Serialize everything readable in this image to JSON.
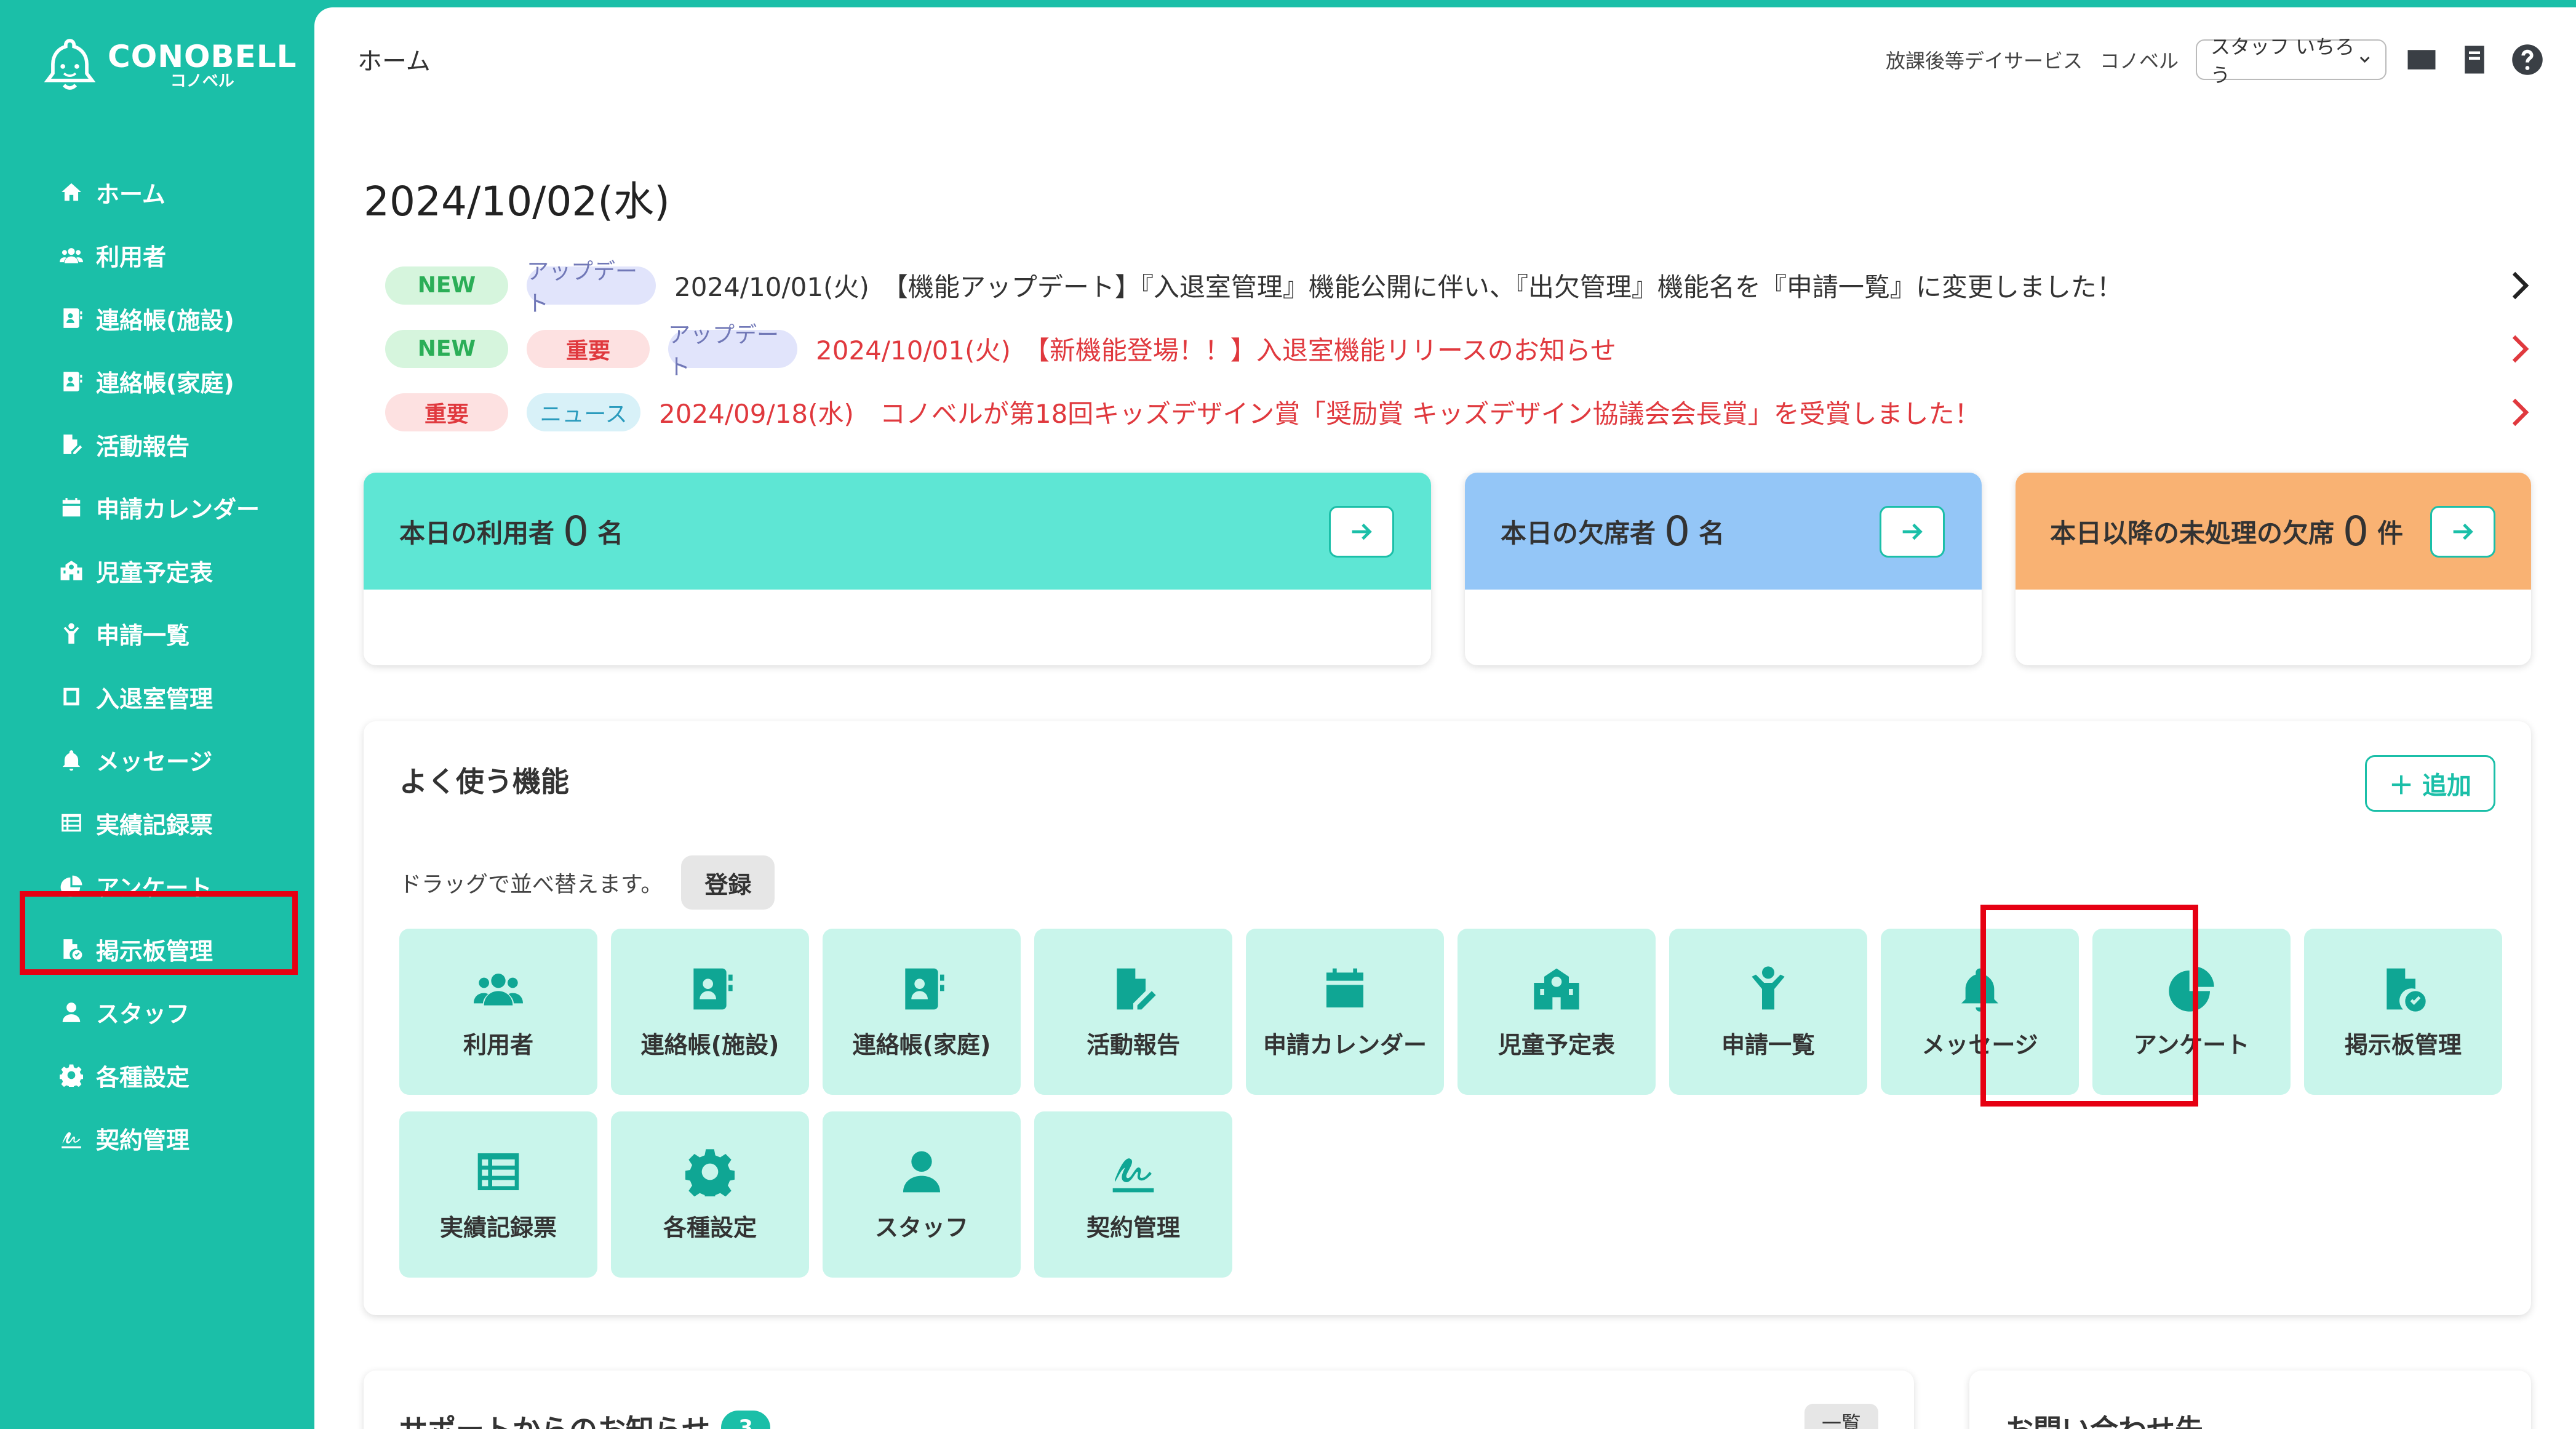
{
  "brand": {
    "name": "CONOBELL",
    "sub": "コノベル"
  },
  "sidebar": {
    "items": [
      {
        "label": "ホーム",
        "icon": "home-icon"
      },
      {
        "label": "利用者",
        "icon": "users-icon"
      },
      {
        "label": "連絡帳(施設)",
        "icon": "contact-book-icon"
      },
      {
        "label": "連絡帳(家庭)",
        "icon": "contact-book-icon"
      },
      {
        "label": "活動報告",
        "icon": "file-edit-icon"
      },
      {
        "label": "申請カレンダー",
        "icon": "calendar-icon"
      },
      {
        "label": "児童予定表",
        "icon": "school-icon"
      },
      {
        "label": "申請一覧",
        "icon": "child-icon"
      },
      {
        "label": "入退室管理",
        "icon": "square-icon"
      },
      {
        "label": "メッセージ",
        "icon": "bell-icon"
      },
      {
        "label": "実績記録票",
        "icon": "list-icon"
      },
      {
        "label": "アンケート",
        "icon": "pie-chart-icon"
      },
      {
        "label": "掲示板管理",
        "icon": "file-check-icon"
      },
      {
        "label": "スタッフ",
        "icon": "staff-icon"
      },
      {
        "label": "各種設定",
        "icon": "gear-icon"
      },
      {
        "label": "契約管理",
        "icon": "signature-icon"
      }
    ]
  },
  "header": {
    "breadcrumb": "ホーム",
    "facility_type": "放課後等デイサービス",
    "facility_name": "コノベル",
    "staff_select": "スタッフ いちろう"
  },
  "date": "2024/10/02(水)",
  "news": [
    {
      "badges": [
        "NEW",
        "アップデート"
      ],
      "text": "2024/10/01(火)　【機能アップデート】『入退室管理』機能公開に伴い、『出欠管理』機能名を『申請一覧』に変更しました！",
      "red": false
    },
    {
      "badges": [
        "NEW",
        "重要",
        "アップデート"
      ],
      "text": "2024/10/01(火)　【新機能登場！！】入退室機能リリースのお知らせ",
      "red": true
    },
    {
      "badges": [
        "重要",
        "ニュース"
      ],
      "text": "2024/09/18(水)　コノベルが第18回キッズデザイン賞「奨励賞 キッズデザイン協議会会長賞」を受賞しました！",
      "red": true
    }
  ],
  "stats": [
    {
      "prefix": "本日の利用者",
      "value": "0",
      "unit": "名",
      "color": "#5ee6d4"
    },
    {
      "prefix": "本日の欠席者",
      "value": "0",
      "unit": "名",
      "color": "#94c6f7"
    },
    {
      "prefix": "本日以降の未処理の欠席",
      "value": "0",
      "unit": "件",
      "color": "#f9b273"
    }
  ],
  "favorites": {
    "title": "よく使う機能",
    "add_label": "＋ 追加",
    "drag_note": "ドラッグで並べ替えます。",
    "register_label": "登録",
    "tiles": [
      {
        "label": "利用者",
        "icon": "users-icon"
      },
      {
        "label": "連絡帳(施設)",
        "icon": "contact-book-icon"
      },
      {
        "label": "連絡帳(家庭)",
        "icon": "contact-book-icon"
      },
      {
        "label": "活動報告",
        "icon": "file-edit-icon"
      },
      {
        "label": "申請カレンダー",
        "icon": "calendar-icon"
      },
      {
        "label": "児童予定表",
        "icon": "school-icon"
      },
      {
        "label": "申請一覧",
        "icon": "child-icon"
      },
      {
        "label": "メッセージ",
        "icon": "bell-icon"
      },
      {
        "label": "アンケート",
        "icon": "pie-chart-icon"
      },
      {
        "label": "掲示板管理",
        "icon": "file-check-icon"
      },
      {
        "label": "実績記録票",
        "icon": "list-icon"
      },
      {
        "label": "各種設定",
        "icon": "gear-icon"
      },
      {
        "label": "スタッフ",
        "icon": "staff-icon"
      },
      {
        "label": "契約管理",
        "icon": "signature-icon"
      }
    ]
  },
  "support": {
    "title": "サポートからのお知らせ",
    "count": "3",
    "list_label": "一覧"
  },
  "contact": {
    "title": "お問い合わせ先"
  }
}
